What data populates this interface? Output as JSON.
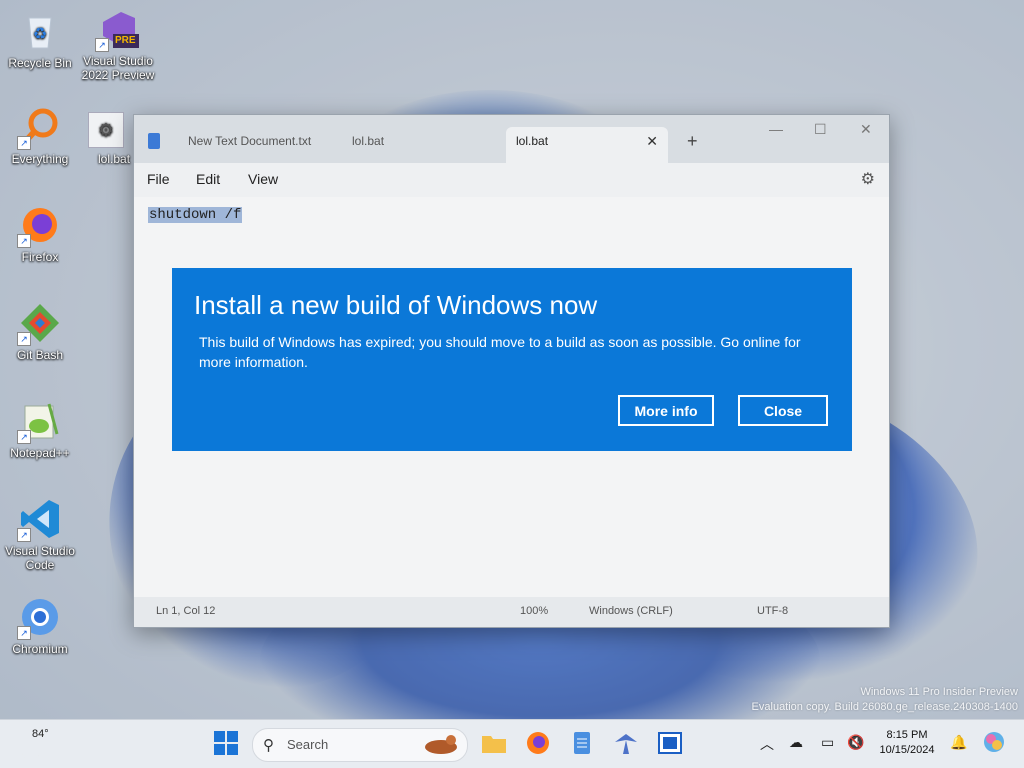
{
  "desktop": {
    "icons": [
      {
        "label": "Recycle Bin",
        "icon": "recycle-bin-icon"
      },
      {
        "label": "Visual Studio 2022 Preview",
        "icon": "visual-studio-preview-icon",
        "badge": "PRE"
      },
      {
        "label": "Everything",
        "icon": "everything-search-icon"
      },
      {
        "label": "lol.bat",
        "icon": "batch-file-icon"
      },
      {
        "label": "Firefox",
        "icon": "firefox-icon"
      },
      {
        "label": "Git Bash",
        "icon": "git-bash-icon"
      },
      {
        "label": "Notepad++",
        "icon": "notepad-plus-plus-icon"
      },
      {
        "label": "Visual Studio Code",
        "icon": "vscode-icon"
      },
      {
        "label": "Chromium",
        "icon": "chromium-icon"
      }
    ]
  },
  "notepad": {
    "tabs": [
      {
        "label": "New Text Document.txt"
      },
      {
        "label": "lol.bat"
      },
      {
        "label": "lol.bat",
        "active": true
      }
    ],
    "add_tab": "+",
    "tab_close": "✕",
    "window_controls": {
      "minimize": "—",
      "maximize": "☐",
      "close": "✕"
    },
    "menu": {
      "file": "File",
      "edit": "Edit",
      "view": "View"
    },
    "content": "shutdown /f",
    "status": {
      "position": "Ln 1, Col 12",
      "zoom": "100%",
      "line_ending": "Windows (CRLF)",
      "encoding": "UTF-8"
    }
  },
  "dialog": {
    "title": "Install a new build of Windows now",
    "message": "This build of Windows has expired; you should move to a build as soon as possible. Go online for more information.",
    "more_info": "More info",
    "close": "Close"
  },
  "watermark": {
    "line1": "Windows 11 Pro Insider Preview",
    "line2": "Evaluation copy. Build 26080.ge_release.240308-1400"
  },
  "taskbar": {
    "weather": "84°",
    "search_placeholder": "Search",
    "time": "8:15 PM",
    "date": "10/15/2024",
    "colors": {
      "accent": "#0b78d8"
    }
  }
}
